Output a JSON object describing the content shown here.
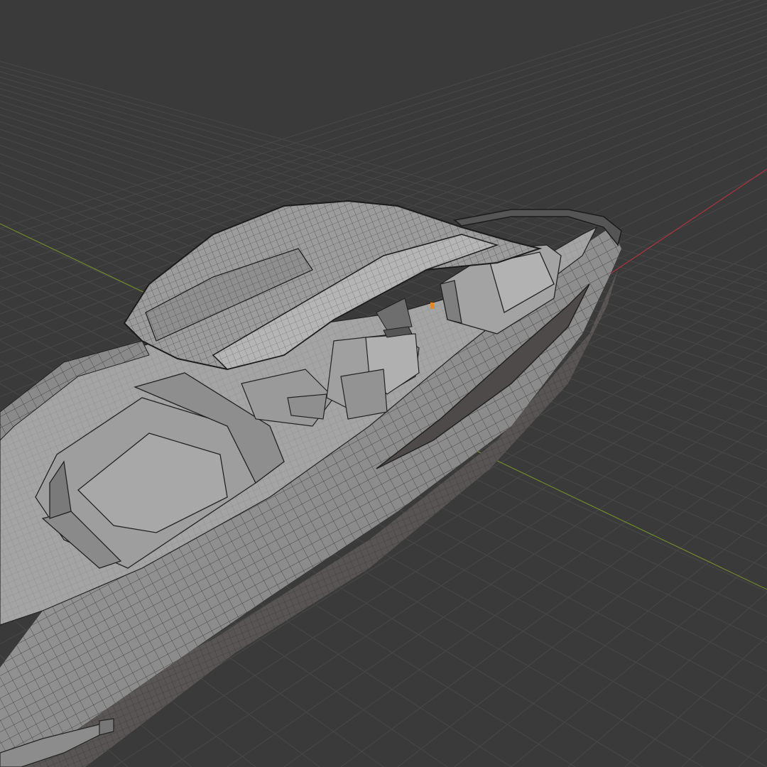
{
  "viewport": {
    "background": "#3a3a3a",
    "grid_color": "#474747",
    "x_axis_color": "#a9343f",
    "y_axis_color": "#6e8a2d",
    "model_fill_light": "#9b9b9b",
    "model_fill_mid": "#7d7d7d",
    "model_fill_dark": "#5a5656",
    "wire_color": "#2a2a2a",
    "accent_orange": "#e08a2a"
  },
  "scene": {
    "object": "boat-hull-wireframe"
  }
}
